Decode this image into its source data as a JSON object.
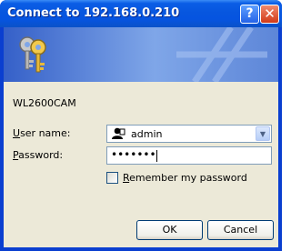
{
  "window": {
    "title": "Connect to 192.168.0.210",
    "help_glyph": "?",
    "close_glyph": "✕"
  },
  "banner": {
    "icon": "keys-icon"
  },
  "dialog": {
    "site_name": "WL2600CAM",
    "username_label_prefix": "U",
    "username_label_rest": "ser name:",
    "username_value": "admin",
    "password_label_prefix": "P",
    "password_label_rest": "assword:",
    "password_value": "•••••••",
    "remember_prefix": "R",
    "remember_rest": "emember my password",
    "remember_checked": false
  },
  "buttons": {
    "ok": "OK",
    "cancel": "Cancel"
  },
  "colors": {
    "titlebar": "#0654e0",
    "client_bg": "#ece9d8",
    "close_button": "#d23a18"
  }
}
